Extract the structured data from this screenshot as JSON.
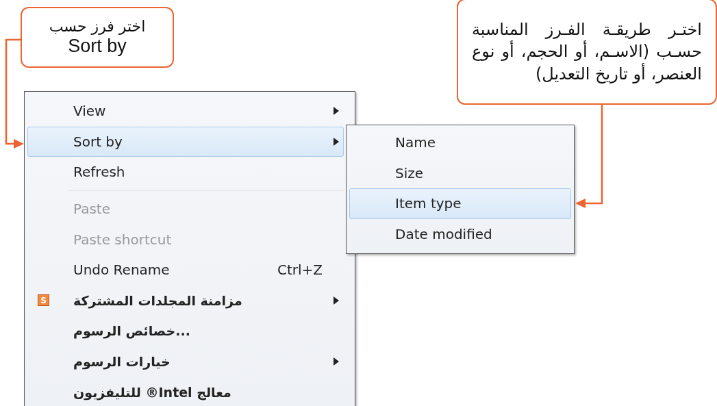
{
  "sort_order_callout": {
    "text": "اختـر طريقـة الفـرز المناسبة حسـب (الاسـم، أو الحجم، أو نوع العنصر، أو تاريخ التعديل)"
  },
  "sort_by_callout": {
    "text": "اختر فرز حسب",
    "subtext": "Sort by"
  },
  "menu": {
    "items": [
      {
        "kind": "item",
        "label": "View",
        "submenu": true,
        "selected": false,
        "disabled": false
      },
      {
        "kind": "item",
        "label": "Sort by",
        "submenu": true,
        "selected": true,
        "disabled": false
      },
      {
        "kind": "item",
        "label": "Refresh",
        "submenu": false,
        "selected": false,
        "disabled": false
      },
      {
        "kind": "separator"
      },
      {
        "kind": "item",
        "label": "Paste",
        "submenu": false,
        "selected": false,
        "disabled": true
      },
      {
        "kind": "item",
        "label": "Paste shortcut",
        "submenu": false,
        "selected": false,
        "disabled": true
      },
      {
        "kind": "item",
        "label": "Undo Rename",
        "shortcut": "Ctrl+Z",
        "submenu": false,
        "selected": false,
        "disabled": false
      },
      {
        "kind": "item",
        "label": "مزامنة المجلدات المشتركة",
        "icon": "S",
        "submenu": true,
        "selected": false,
        "disabled": false
      },
      {
        "kind": "item",
        "label": "...خصائص الرسوم",
        "submenu": false,
        "selected": false,
        "disabled": false
      },
      {
        "kind": "item",
        "label": "خيارات الرسوم",
        "submenu": true,
        "selected": false,
        "disabled": false
      },
      {
        "kind": "item",
        "label": "معالج Intel® للتليفزيون",
        "submenu": false,
        "selected": false,
        "disabled": false
      }
    ]
  },
  "submenu": {
    "items": [
      {
        "label": "Name",
        "selected": false
      },
      {
        "label": "Size",
        "selected": false
      },
      {
        "label": "Item type",
        "selected": true
      },
      {
        "label": "Date modified",
        "selected": false
      }
    ]
  }
}
